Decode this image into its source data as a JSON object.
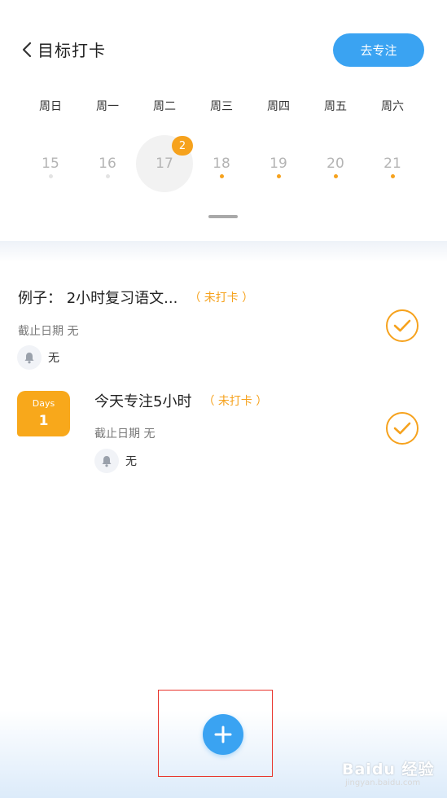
{
  "header": {
    "title": "目标打卡",
    "focus_button": "去专注"
  },
  "calendar": {
    "weekdays": [
      "周日",
      "周一",
      "周二",
      "周三",
      "周四",
      "周五",
      "周六"
    ],
    "dates": [
      {
        "day": "15",
        "dot": "grey"
      },
      {
        "day": "16",
        "dot": "grey"
      },
      {
        "day": "17",
        "selected": true,
        "badge": "2"
      },
      {
        "day": "18",
        "dot": "orange"
      },
      {
        "day": "19",
        "dot": "orange"
      },
      {
        "day": "20",
        "dot": "orange"
      },
      {
        "day": "21",
        "dot": "orange"
      }
    ]
  },
  "tasks": [
    {
      "title": "例子： 2小时复习语文...",
      "status": "（ 未打卡 ）",
      "deadline": "截止日期 无",
      "remind": "无"
    },
    {
      "days_label": "Days",
      "days_value": "1",
      "title": "今天专注5小时",
      "status": "（ 未打卡 ）",
      "deadline": "截止日期 无",
      "remind": "无"
    }
  ],
  "watermark": {
    "text": "Baidu 经验",
    "sub": "jingyan.baidu.com"
  },
  "colors": {
    "accent_blue": "#3aa3f2",
    "accent_orange": "#f6a21d"
  }
}
